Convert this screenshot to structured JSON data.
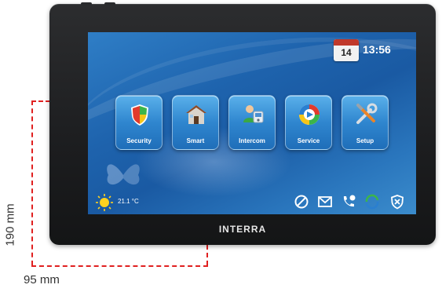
{
  "device": {
    "brand": "INTERRA",
    "bezel_color": "#1e1f21"
  },
  "screen": {
    "calendar_day": "14",
    "time": "13:56",
    "background_color": "#1f64ae",
    "apps": [
      {
        "label": "Security",
        "icon": "shield-icon"
      },
      {
        "label": "Smart",
        "icon": "house-icon"
      },
      {
        "label": "Intercom",
        "icon": "intercom-icon"
      },
      {
        "label": "Service",
        "icon": "service-icon"
      },
      {
        "label": "Setup",
        "icon": "tools-icon"
      }
    ],
    "status_bar": {
      "temperature": "21.1 °C",
      "weather_icon": "sun-icon",
      "icons": [
        "do-not-disturb-icon",
        "mail-icon",
        "phone-icon",
        "sync-icon",
        "shield-alarm-icon"
      ]
    }
  },
  "dimensions": {
    "height_label": "190 mm",
    "width_label": "95 mm",
    "line_color": "#e02020"
  }
}
